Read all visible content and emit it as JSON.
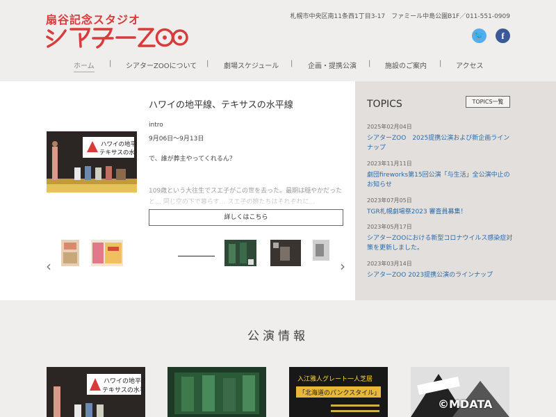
{
  "header": {
    "logo_sub": "扇谷記念スタジオ",
    "logo_main": "シアターZOO",
    "address": "札幌市中央区南11条西1丁目3-17　ファミール中島公園B1F／011-551-0909",
    "social": {
      "twitter_glyph": "🐦",
      "facebook_glyph": "f"
    }
  },
  "nav": {
    "items": [
      "ホーム",
      "シアターZOOについて",
      "劇場スケジュール",
      "企画・提携公演",
      "施設のご案内",
      "アクセス"
    ],
    "separator": "|"
  },
  "featured": {
    "title": "ハワイの地平線、テキサスの水平線",
    "intro": "intro",
    "date": "9月06日～9月13日",
    "quote": "で、誰が葬主やってくれるん？",
    "description": "109歳という大往生でスエ子がこの世を去った。最期は穏やかだったと… 同じ空の下で暮らす… スエ子の娘たちはそれぞれに…",
    "details_label": "詳しくはこちら",
    "poster_text": [
      "ハワイの地平線、",
      "テキサスの水平線"
    ]
  },
  "carousel": {
    "prev_glyph": "‹",
    "next_glyph": "›"
  },
  "topics": {
    "title": "TOPICS",
    "all_label": "TOPICS一覧",
    "items": [
      {
        "date": "2025年02月04日",
        "title": "シアターZOO　2025提携公演および新企画ラインナップ"
      },
      {
        "date": "2023年11月11日",
        "title": "劇団fireworks第15回公演「与生活」全公演中止のお知らせ"
      },
      {
        "date": "2023年07月05日",
        "title": "TGR札幌劇場祭2023 審査員募集！"
      },
      {
        "date": "2023年05月17日",
        "title": "シアターZOOにおける新型コロナウイルス感染症対策を更新しました。"
      },
      {
        "date": "2023年03月14日",
        "title": "シアターZOO 2023提携公演のラインナップ"
      }
    ]
  },
  "performances": {
    "section_title": "公演情報",
    "card3_text": [
      "入江雅人グレート一人芝居",
      "「北海道のパンクスタイル」"
    ]
  },
  "watermark": "©MDATA",
  "colors": {
    "brand_red": "#d93a3a",
    "link_blue": "#2b6aa8"
  }
}
